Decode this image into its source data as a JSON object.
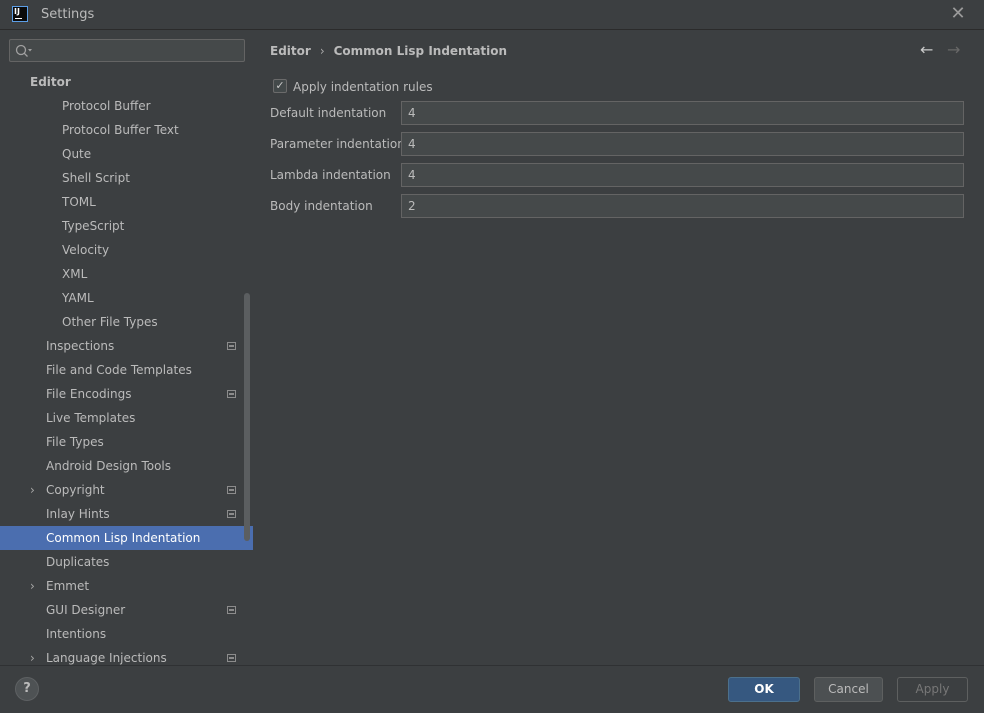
{
  "window": {
    "title": "Settings"
  },
  "sidebar": {
    "search_placeholder": "",
    "items": [
      {
        "label": "Editor",
        "indent": 30,
        "bold": true
      },
      {
        "label": "Protocol Buffer",
        "indent": 62
      },
      {
        "label": "Protocol Buffer Text",
        "indent": 62
      },
      {
        "label": "Qute",
        "indent": 62
      },
      {
        "label": "Shell Script",
        "indent": 62
      },
      {
        "label": "TOML",
        "indent": 62
      },
      {
        "label": "TypeScript",
        "indent": 62
      },
      {
        "label": "Velocity",
        "indent": 62
      },
      {
        "label": "XML",
        "indent": 62
      },
      {
        "label": "YAML",
        "indent": 62
      },
      {
        "label": "Other File Types",
        "indent": 62
      },
      {
        "label": "Inspections",
        "indent": 46,
        "project_icon": true
      },
      {
        "label": "File and Code Templates",
        "indent": 46
      },
      {
        "label": "File Encodings",
        "indent": 46,
        "project_icon": true
      },
      {
        "label": "Live Templates",
        "indent": 46
      },
      {
        "label": "File Types",
        "indent": 46
      },
      {
        "label": "Android Design Tools",
        "indent": 46
      },
      {
        "label": "Copyright",
        "indent": 46,
        "expandable": true,
        "project_icon": true
      },
      {
        "label": "Inlay Hints",
        "indent": 46,
        "project_icon": true
      },
      {
        "label": "Common Lisp Indentation",
        "indent": 46,
        "selected": true
      },
      {
        "label": "Duplicates",
        "indent": 46
      },
      {
        "label": "Emmet",
        "indent": 46,
        "expandable": true
      },
      {
        "label": "GUI Designer",
        "indent": 46,
        "project_icon": true
      },
      {
        "label": "Intentions",
        "indent": 46
      },
      {
        "label": "Language Injections",
        "indent": 46,
        "expandable": true,
        "project_icon": true
      }
    ]
  },
  "breadcrumb": {
    "parent": "Editor",
    "separator": "›",
    "current": "Common Lisp Indentation"
  },
  "nav": {
    "back_icon": "←",
    "forward_icon": "→"
  },
  "settings": {
    "apply_rules": {
      "label": "Apply indentation rules",
      "checked": true,
      "check_glyph": "✓"
    },
    "fields": [
      {
        "label": "Default indentation",
        "value": "4"
      },
      {
        "label": "Parameter indentation",
        "value": "4"
      },
      {
        "label": "Lambda indentation",
        "value": "4"
      },
      {
        "label": "Body indentation",
        "value": "2"
      }
    ]
  },
  "footer": {
    "help_label": "?",
    "ok_label": "OK",
    "cancel_label": "Cancel",
    "apply_label": "Apply"
  },
  "colors": {
    "selection": "#4b6eaf",
    "background": "#3c3f41",
    "primary_button": "#365880"
  }
}
